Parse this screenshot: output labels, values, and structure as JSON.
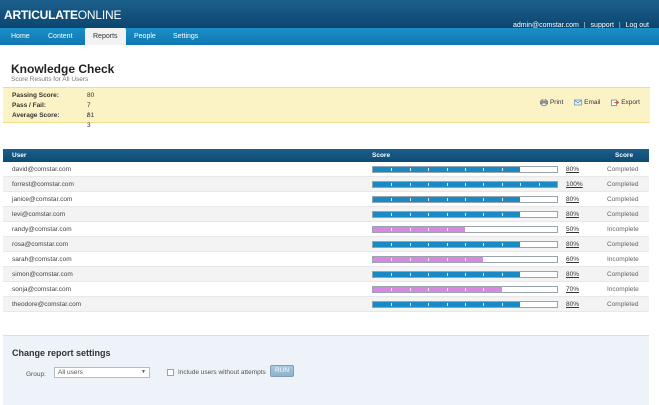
{
  "header": {
    "logo_bold": "ARTICULATE",
    "logo_light": "ONLINE",
    "user_email": "admin@comstar.com",
    "sep": "|",
    "support": "support",
    "logout": "Log out"
  },
  "nav": {
    "items": [
      {
        "label": "Home"
      },
      {
        "label": "Content"
      },
      {
        "label": "Reports"
      },
      {
        "label": "People"
      },
      {
        "label": "Settings"
      }
    ],
    "active": "Reports"
  },
  "page": {
    "title": "Knowledge Check",
    "subtitle": "Score Results for All Users"
  },
  "summary": {
    "passing_label": "Passing Score:",
    "passing_value": "80",
    "passfail_label": "Pass / Fail:",
    "passfail_value": "7 / 3",
    "average_label": "Average Score:",
    "average_value": "81"
  },
  "actions": {
    "print": "Print",
    "email": "Email",
    "export": "Export"
  },
  "table": {
    "col_user": "User",
    "col_score": "Score",
    "col_status": "Score",
    "rows": [
      {
        "user": "david@comstar.com",
        "score": 80,
        "pct": "80%",
        "status": "Completed",
        "result": "pass"
      },
      {
        "user": "forrest@comstar.com",
        "score": 100,
        "pct": "100%",
        "status": "Completed",
        "result": "pass"
      },
      {
        "user": "janice@comstar.com",
        "score": 80,
        "pct": "80%",
        "status": "Completed",
        "result": "pass"
      },
      {
        "user": "levi@comstar.com",
        "score": 80,
        "pct": "80%",
        "status": "Completed",
        "result": "pass"
      },
      {
        "user": "randy@comstar.com",
        "score": 50,
        "pct": "50%",
        "status": "Incomplete",
        "result": "fail"
      },
      {
        "user": "rosa@comstar.com",
        "score": 80,
        "pct": "80%",
        "status": "Completed",
        "result": "pass"
      },
      {
        "user": "sarah@comstar.com",
        "score": 60,
        "pct": "60%",
        "status": "Incomplete",
        "result": "fail"
      },
      {
        "user": "simon@comstar.com",
        "score": 80,
        "pct": "80%",
        "status": "Completed",
        "result": "pass"
      },
      {
        "user": "sonja@comstar.com",
        "score": 70,
        "pct": "70%",
        "status": "Incomplete",
        "result": "fail"
      },
      {
        "user": "theodore@comstar.com",
        "score": 80,
        "pct": "80%",
        "status": "Completed",
        "result": "pass"
      }
    ]
  },
  "settings": {
    "title": "Change report settings",
    "group_label": "Group:",
    "group_value": "All users",
    "include_label": "Include users without attempts",
    "run_label": "RUN"
  },
  "colors": {
    "header": "#0b4670",
    "nav": "#1a8fc7",
    "bar_pass": "#1a8ac4",
    "bar_fail": "#d688e3",
    "summary_bg": "#fbf3c6"
  },
  "icons": [
    "printer-icon",
    "envelope-icon",
    "export-icon",
    "chevron-down-icon"
  ]
}
